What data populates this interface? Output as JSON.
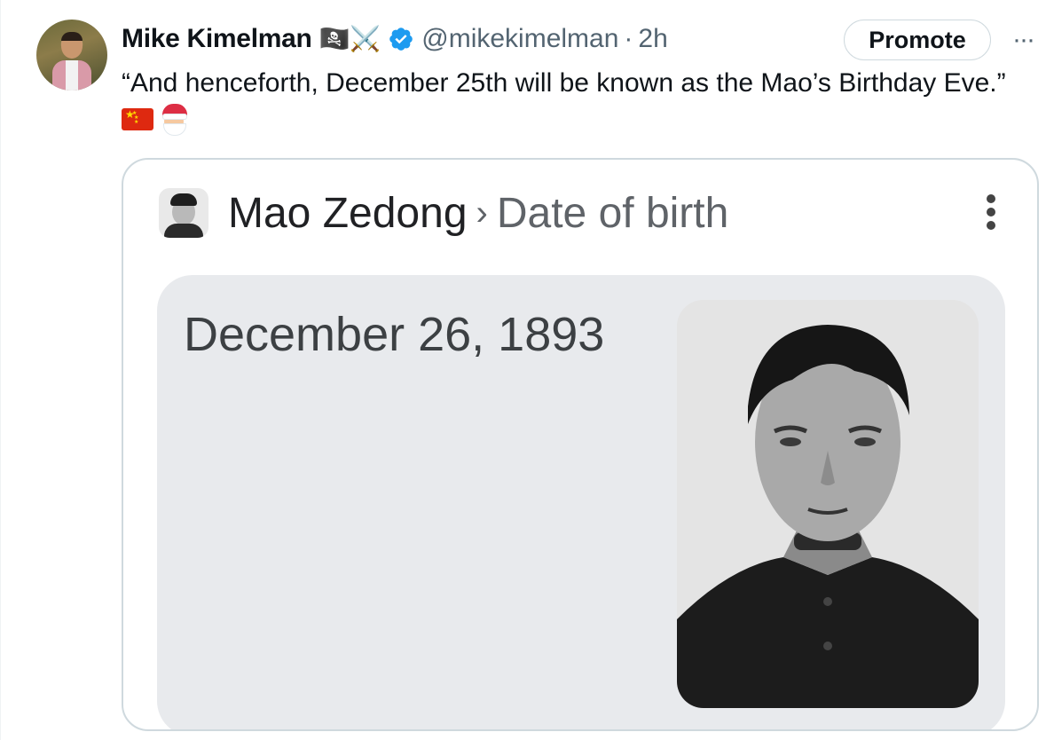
{
  "tweet": {
    "display_name": "Mike Kimelman",
    "name_emojis": "🏴‍☠️⚔️",
    "handle": "@mikekimelman",
    "separator": "·",
    "time": "2h",
    "promote_label": "Promote",
    "more_label": "···",
    "text": "“And henceforth, December 25th will be known as the Mao’s Birthday Eve.”",
    "trailing_emojis": [
      "flag-china",
      "santa-claus"
    ]
  },
  "media": {
    "entity": "Mao Zedong",
    "breadcrumb_separator": "›",
    "attribute": "Date of birth",
    "answer": "December 26, 1893"
  },
  "colors": {
    "verified_blue": "#1d9bf0",
    "secondary_text": "#536471",
    "card_background": "#e8eaed"
  }
}
